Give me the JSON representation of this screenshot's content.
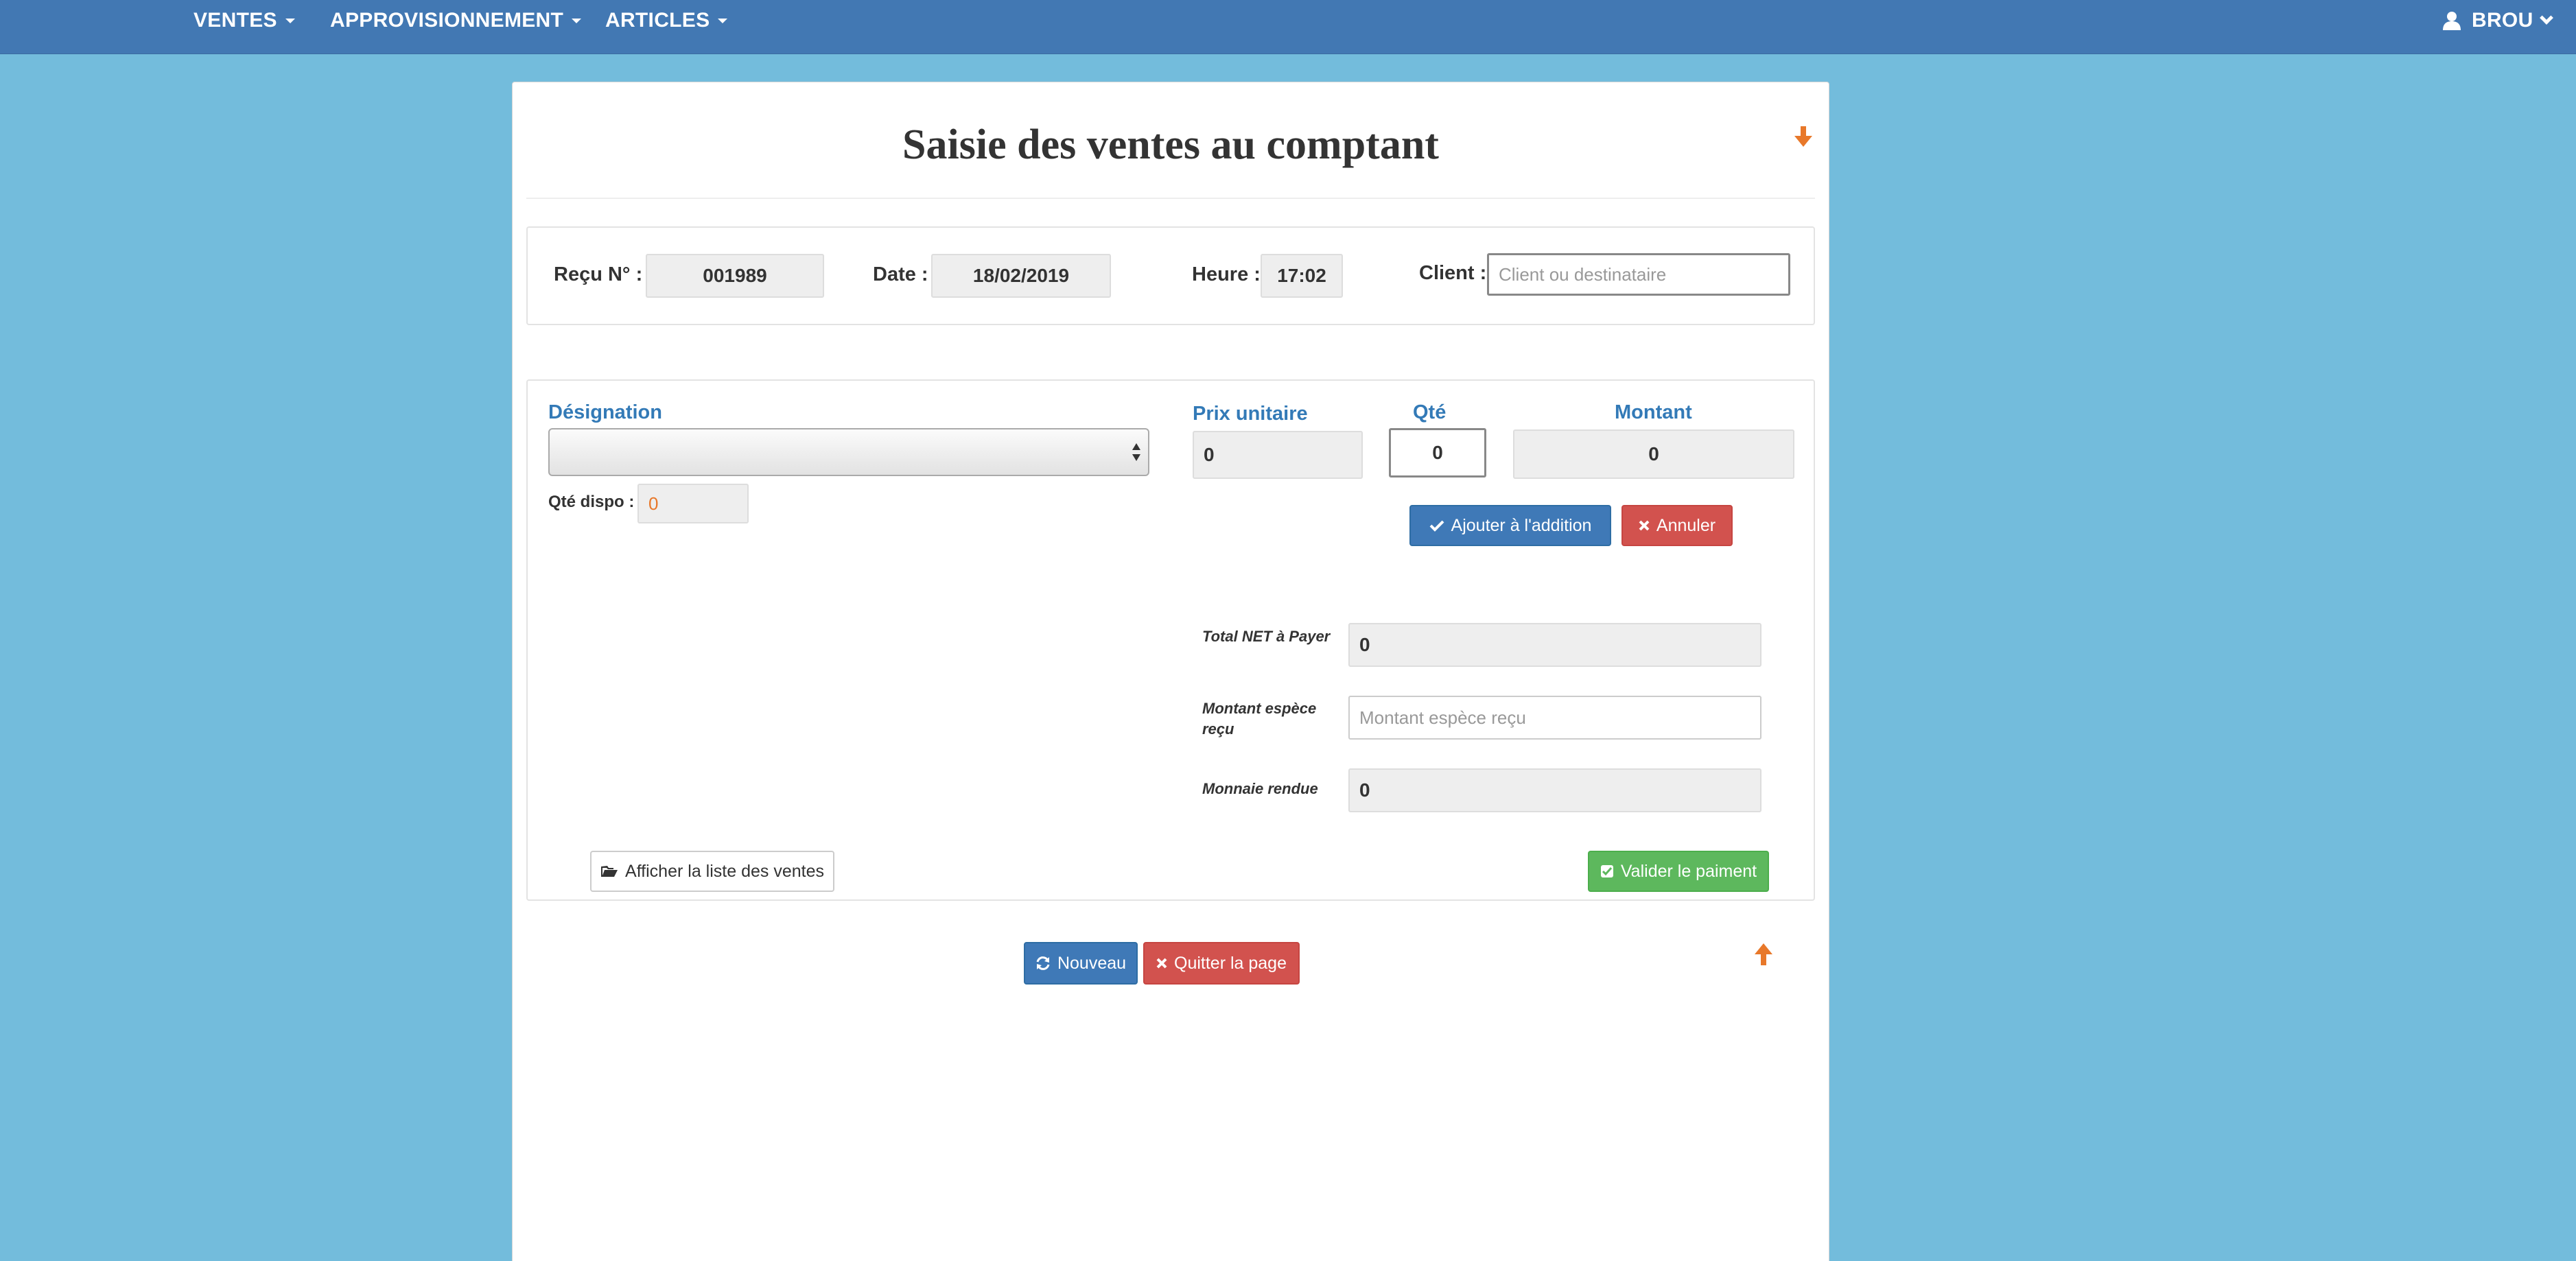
{
  "nav": {
    "items": [
      {
        "label": "VENTES"
      },
      {
        "label": "APPROVISIONNEMENT"
      },
      {
        "label": "ARTICLES"
      }
    ],
    "user": {
      "label": "BROU"
    }
  },
  "page": {
    "title": "Saisie des ventes au comptant"
  },
  "header_form": {
    "recu_label": "Reçu N° :",
    "recu_value": "001989",
    "date_label": "Date :",
    "date_value": "18/02/2019",
    "heure_label": "Heure :",
    "heure_value": "17:02",
    "client_label": "Client :",
    "client_placeholder": "Client ou destinataire"
  },
  "line_form": {
    "designation_label": "Désignation",
    "designation_value": "",
    "prix_label": "Prix unitaire",
    "prix_value": "0",
    "qte_label": "Qté",
    "qte_value": "0",
    "montant_label": "Montant",
    "montant_value": "0",
    "qte_dispo_label": "Qté dispo :",
    "qte_dispo_value": "0",
    "add_button": "Ajouter à l'addition",
    "cancel_button": "Annuler"
  },
  "payment": {
    "total_label": "Total NET à Payer",
    "total_value": "0",
    "cash_label": "Montant espèce reçu",
    "cash_placeholder": "Montant espèce reçu",
    "change_label": "Monnaie rendue",
    "change_value": "0",
    "list_button": "Afficher la liste des ventes",
    "validate_button": "Valider le paiment"
  },
  "footer": {
    "new_button": "Nouveau",
    "quit_button": "Quitter la page"
  },
  "colors": {
    "background": "#73bcdc",
    "navbar": "#4278b3",
    "primary": "#3f79b7",
    "danger": "#d2524e",
    "success": "#5db85d",
    "accent_orange": "#e8782a",
    "label_blue": "#337ab7"
  }
}
